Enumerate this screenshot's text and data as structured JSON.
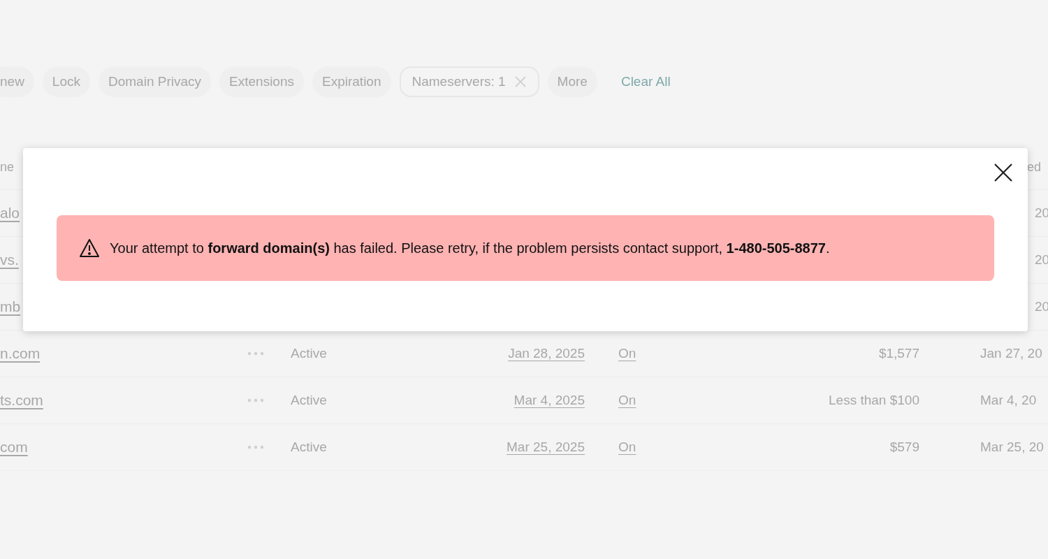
{
  "filters": [
    {
      "label": "new",
      "kind": "plain"
    },
    {
      "label": "Lock",
      "kind": "plain"
    },
    {
      "label": "Domain Privacy",
      "kind": "plain"
    },
    {
      "label": "Extensions",
      "kind": "plain"
    },
    {
      "label": "Expiration",
      "kind": "plain"
    },
    {
      "label": "Nameservers: 1",
      "kind": "applied"
    },
    {
      "label": "More",
      "kind": "plain"
    }
  ],
  "clear_all": "Clear All",
  "table": {
    "header": {
      "column_1": "ne",
      "column_2": "ed"
    },
    "rows": [
      {
        "domain": "alo",
        "registered": "20"
      },
      {
        "domain": "vs.",
        "registered": "20"
      },
      {
        "domain": "mb",
        "registered": "20"
      },
      {
        "domain": "n.com",
        "status": "Active",
        "expires": "Jan 28, 2025",
        "auto_renew": "On",
        "value": "$1,577",
        "registered": "Jan 27, 20"
      },
      {
        "domain": "ts.com",
        "status": "Active",
        "expires": "Mar 4, 2025",
        "auto_renew": "On",
        "value": "Less than $100",
        "registered": "Mar 4, 20"
      },
      {
        "domain": "com",
        "status": "Active",
        "expires": "Mar 25, 2025",
        "auto_renew": "On",
        "value": "$579",
        "registered": "Mar 25, 20"
      }
    ]
  },
  "dialog": {
    "message": "Your attempt to **forward domain(s)** has failed. Please retry, if the problem persists contact support, **1-480-505-8877**."
  }
}
